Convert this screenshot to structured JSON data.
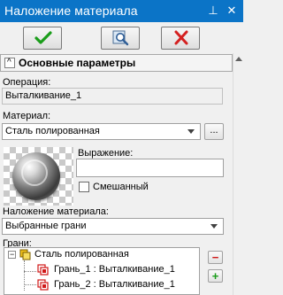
{
  "window": {
    "title": "Наложение материала",
    "pin_glyph": "⊥",
    "close_glyph": "✕"
  },
  "toolbar": {
    "ok_icon": "green-check-icon",
    "preview_icon": "preview-magnifier-icon",
    "cancel_icon": "red-x-icon"
  },
  "section": {
    "collapse_glyph": "^",
    "title": "Основные параметры"
  },
  "operation": {
    "label": "Операция:",
    "value": "Выталкивание_1"
  },
  "material": {
    "label": "Материал:",
    "value": "Сталь полированная",
    "browse_label": "..."
  },
  "expression": {
    "label": "Выражение:",
    "value": ""
  },
  "mixed": {
    "label": "Смешанный",
    "checked": false
  },
  "mapping": {
    "label": "Наложение материала:",
    "value": "Выбранные грани"
  },
  "faces": {
    "label": "Грани:",
    "root": "Сталь полированная",
    "items": [
      {
        "label": "Грань_1 : Выталкивание_1"
      },
      {
        "label": "Грань_2 : Выталкивание_1"
      }
    ],
    "remove_glyph": "−",
    "add_glyph": "+"
  },
  "colors": {
    "titlebar": "#0b74c7",
    "ok_green": "#1a9d1a",
    "cancel_red": "#d42020",
    "face_red": "#d01818",
    "material_yellow": "#f2c21a"
  }
}
